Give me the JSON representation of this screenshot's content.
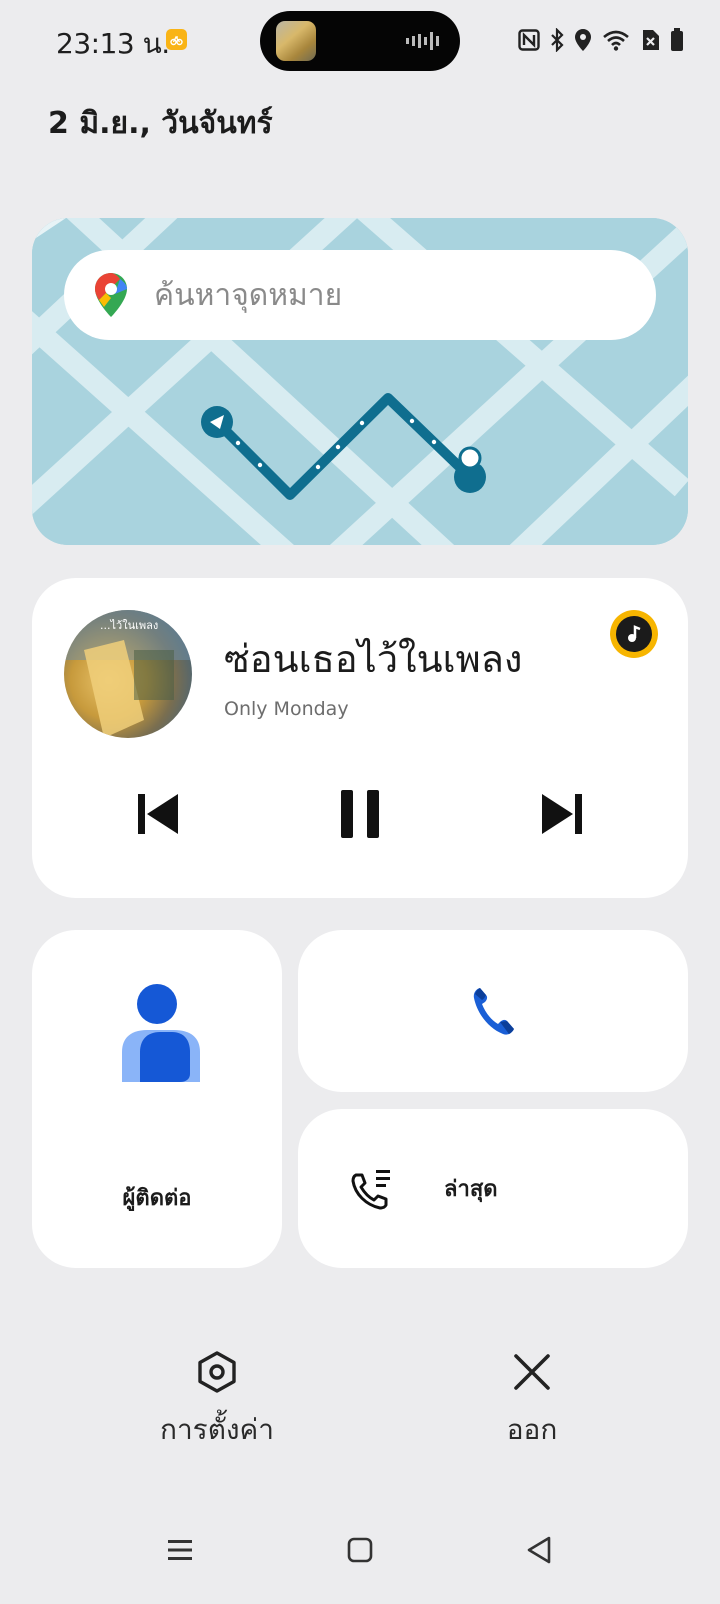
{
  "status_bar": {
    "time": "23:13 น.",
    "icons": [
      "app-notification-icon",
      "nfc-icon",
      "bluetooth-icon",
      "location-icon",
      "wifi-icon",
      "no-sim-icon",
      "battery-icon"
    ]
  },
  "date": "2 มิ.ย., วันจันทร์",
  "map": {
    "search_placeholder": "ค้นหาจุดหมาย"
  },
  "media": {
    "album_overlay": "...ไว้ในเพลง",
    "title": "ซ่อนเธอไว้ในเพลง",
    "artist": "Only Monday"
  },
  "tiles": {
    "contacts_label": "ผู้ติดต่อ",
    "recents_label": "ล่าสุด"
  },
  "actions": {
    "settings_label": "การตั้งค่า",
    "exit_label": "ออก"
  },
  "colors": {
    "background": "#ececee",
    "map_water": "#a9d3de",
    "route": "#0f6e8f",
    "accent_blue": "#1a5fd6",
    "music_yellow": "#f7b500"
  }
}
